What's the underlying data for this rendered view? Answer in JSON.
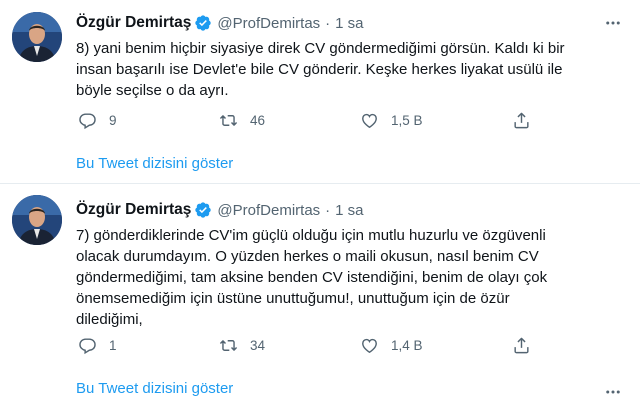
{
  "tweets": [
    {
      "author_name": "Özgür Demirtaş",
      "handle": "@ProfDemirtas",
      "separator": "·",
      "time": "1 sa",
      "text_lines": [
        "8) yani benim hiçbir siyasiye direk CV göndermediğimi görsün. Kaldı ki bir",
        "insan başarılı ise Devlet'e bile CV gönderir. Keşke herkes liyakat usülü ile",
        "böyle seçilse o da ayrı."
      ],
      "reply_count": "9",
      "retweet_count": "46",
      "like_count": "1,5 B",
      "thread_link": "Bu Tweet dizisini göster"
    },
    {
      "author_name": "Özgür Demirtaş",
      "handle": "@ProfDemirtas",
      "separator": "·",
      "time": "1 sa",
      "text_lines": [
        "7) gönderdiklerinde CV'im güçlü olduğu için mutlu huzurlu ve özgüvenli",
        "olacak durumdayım. O yüzden herkes o maili okusun, nasıl benim CV",
        "göndermediğimi, tam aksine benden CV istendiğini, benim de olayı çok",
        "önemsemediğim için üstüne unuttuğumu!, unuttuğum için de özür",
        "dilediğimi,"
      ],
      "reply_count": "1",
      "retweet_count": "34",
      "like_count": "1,4 B",
      "thread_link": "Bu Tweet dizisini göster"
    }
  ],
  "icons": {
    "verified": "verified-badge-icon",
    "reply": "reply-icon",
    "retweet": "retweet-icon",
    "like": "heart-icon",
    "share": "share-icon",
    "more": "more-options-icon"
  },
  "colors": {
    "link": "#1d9bf0",
    "secondary_text": "#536471",
    "verified": "#1d9bf0",
    "divider": "#e6ecf0"
  }
}
